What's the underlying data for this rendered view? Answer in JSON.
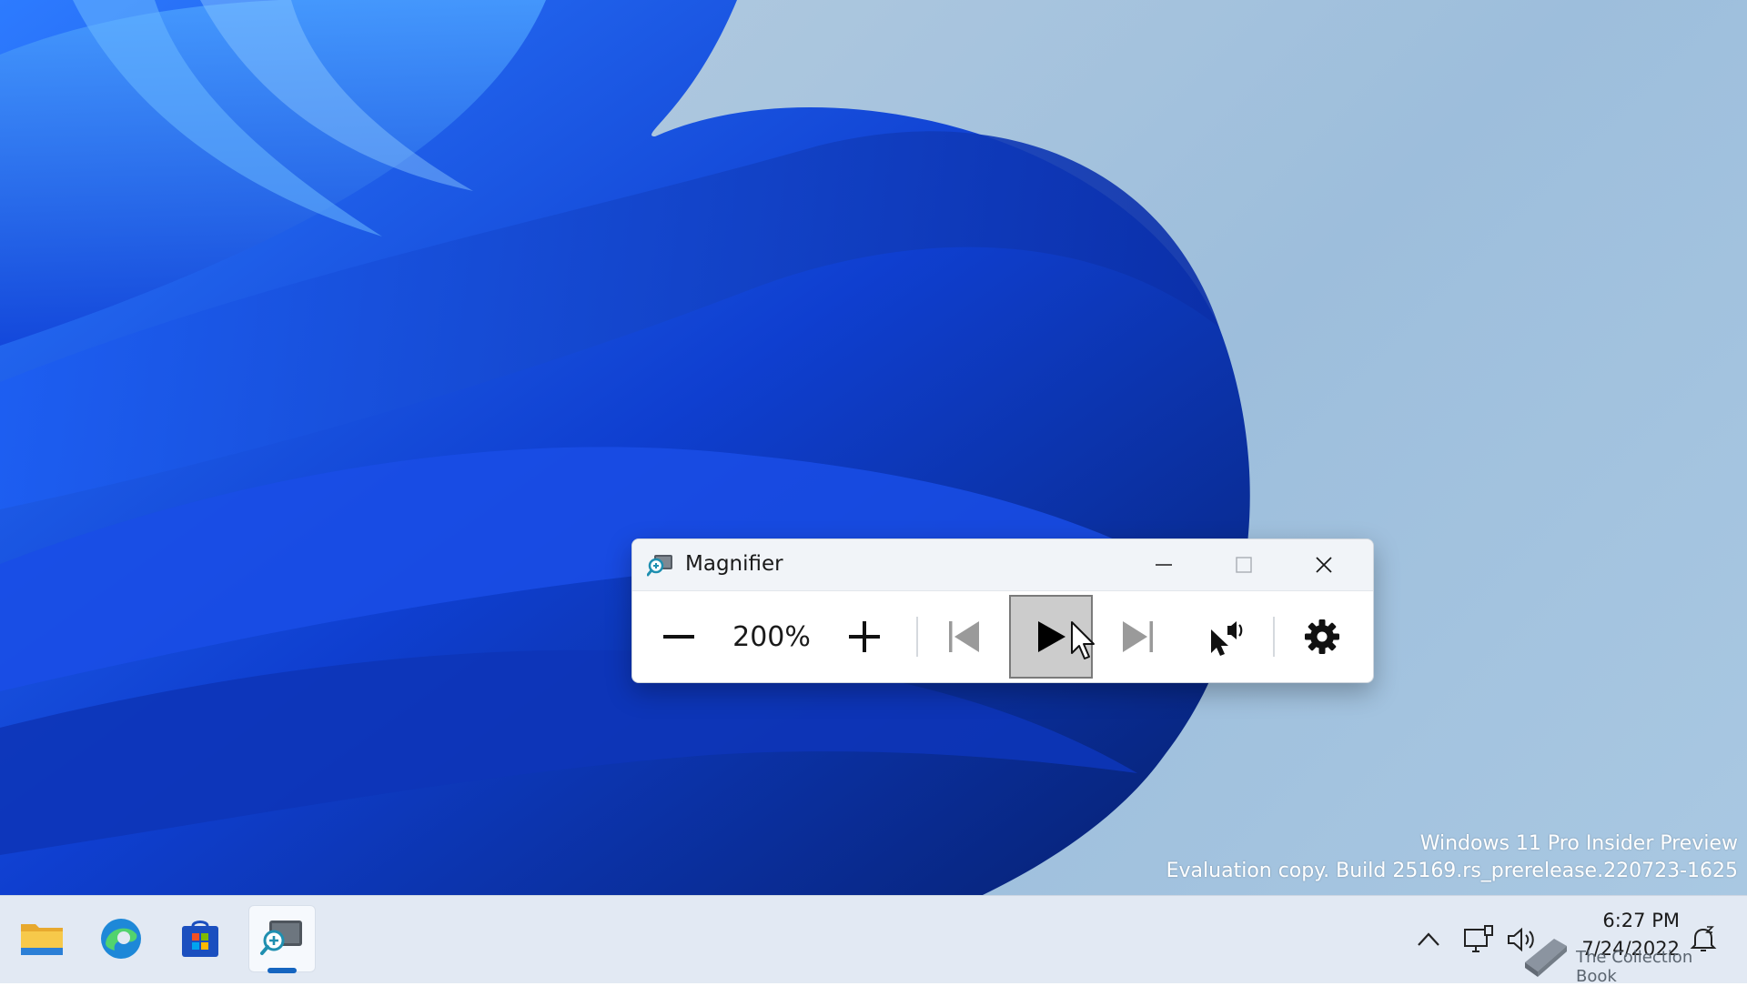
{
  "desktop": {
    "watermark_line1": "Windows 11 Pro Insider Preview",
    "watermark_line2": "Evaluation copy. Build 25169.rs_prerelease.220723-1625"
  },
  "magnifier": {
    "title": "Magnifier",
    "zoom_level": "200%",
    "buttons": {
      "zoom_out": "minus-icon",
      "zoom_in": "plus-icon",
      "previous": "skip-previous-icon",
      "play": "play-icon",
      "next": "skip-next-icon",
      "read_from_here": "pointer-speaker-icon",
      "settings": "gear-icon"
    },
    "window_controls": [
      "minimize-icon",
      "maximize-icon",
      "close-icon"
    ]
  },
  "taskbar": {
    "apps": [
      "file-explorer-icon",
      "edge-icon",
      "store-icon",
      "magnifier-icon"
    ],
    "active_app": "Magnifier",
    "clock_time": "6:27 PM",
    "clock_date": "7/24/2022"
  },
  "overlay": {
    "collection_book_text": "The Collection Book"
  },
  "colors": {
    "wallpaper_blue": "#1a47d6",
    "taskbar_bg": "#e2e9f3",
    "active_indicator": "#1565c0",
    "play_button_bg": "#cccccc"
  }
}
